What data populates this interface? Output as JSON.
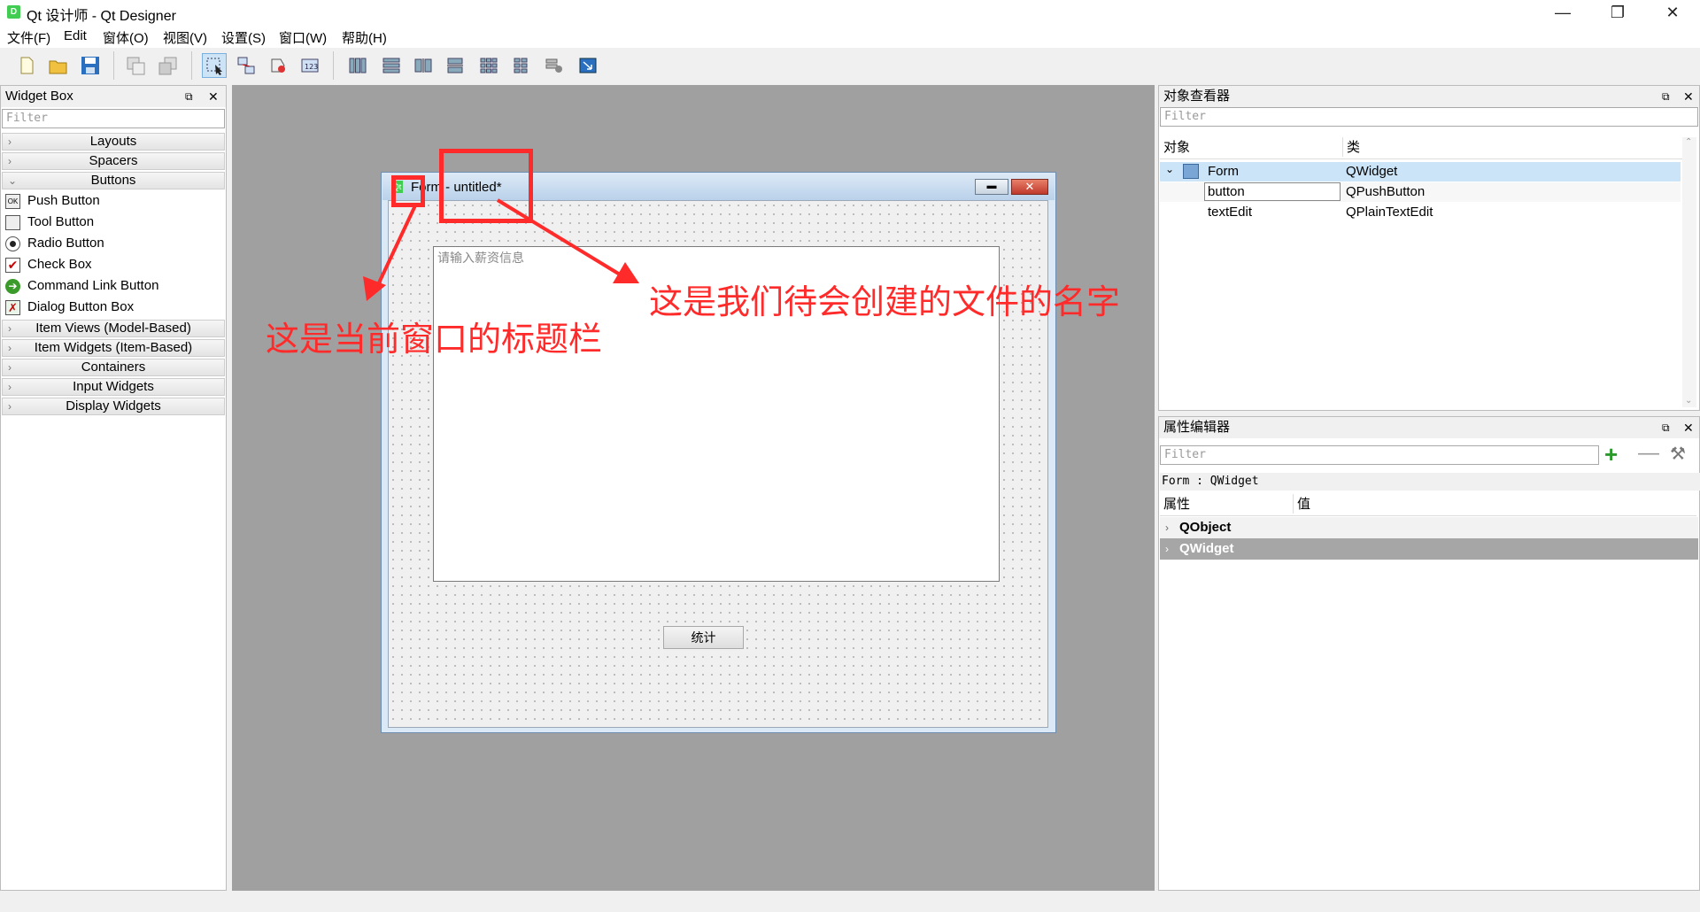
{
  "window": {
    "title": "Qt 设计师 - Qt Designer",
    "minimize": "—",
    "maximize": "❐",
    "close": "✕"
  },
  "menubar": {
    "items": [
      "文件(F)",
      "Edit",
      "窗体(O)",
      "视图(V)",
      "设置(S)",
      "窗口(W)",
      "帮助(H)"
    ]
  },
  "widget_box": {
    "title": "Widget Box",
    "filter_placeholder": "Filter",
    "categories": [
      "Layouts",
      "Spacers",
      "Buttons",
      "Item Views (Model-Based)",
      "Item Widgets (Item-Based)",
      "Containers",
      "Input Widgets",
      "Display Widgets"
    ],
    "buttons": [
      "Push Button",
      "Tool Button",
      "Radio Button",
      "Check Box",
      "Command Link Button",
      "Dialog Button Box"
    ]
  },
  "form": {
    "title": "Form - untitled*",
    "textedit_placeholder": "请输入薪资信息",
    "button_label": "统计"
  },
  "object_inspector": {
    "title": "对象查看器",
    "filter_placeholder": "Filter",
    "col_object": "对象",
    "col_class": "类",
    "rows": [
      {
        "object": "Form",
        "class": "QWidget"
      },
      {
        "object": "button",
        "class": "QPushButton"
      },
      {
        "object": "textEdit",
        "class": "QPlainTextEdit"
      }
    ]
  },
  "property_editor": {
    "title": "属性编辑器",
    "filter_placeholder": "Filter",
    "context": "Form : QWidget",
    "col_property": "属性",
    "col_value": "值",
    "groups": [
      "QObject",
      "QWidget"
    ]
  },
  "annotations": {
    "titlebar_note": "这是当前窗口的标题栏",
    "filename_note": "这是我们待会创建的文件的名字",
    "color": "#ff2a2a"
  }
}
